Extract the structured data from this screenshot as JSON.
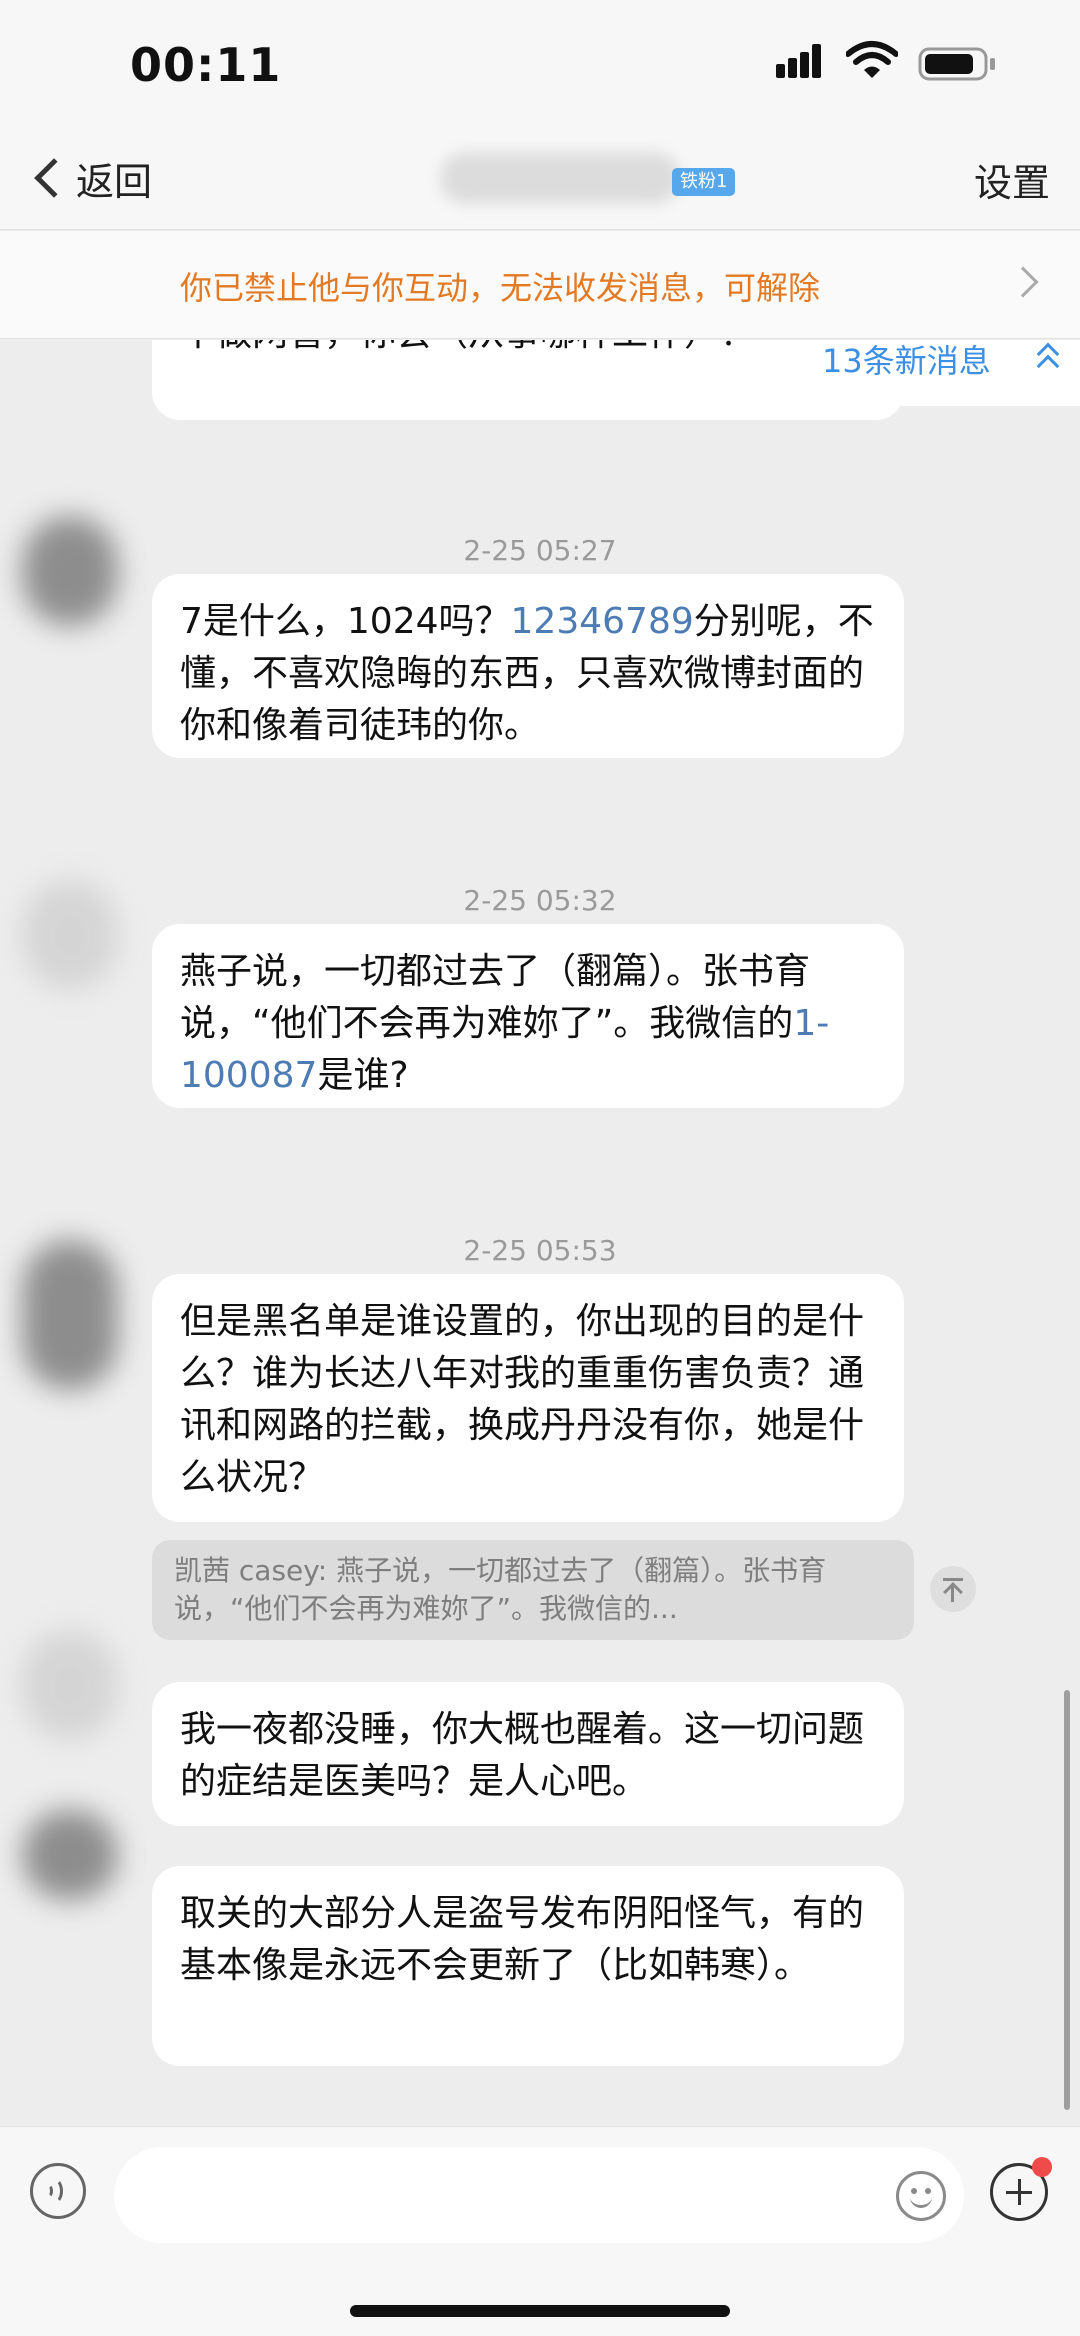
{
  "status_bar": {
    "time": "00:11"
  },
  "nav": {
    "back_label": "返回",
    "contact_badge": "铁粉1",
    "settings_label": "设置"
  },
  "banner": {
    "text": "你已禁止他与你互动，无法收发消息，可解除"
  },
  "new_messages": {
    "label": "13条新消息"
  },
  "messages": {
    "m0": "不做网管，你会（从事哪种工作）？",
    "t1": "2-25 05:27",
    "m1": {
      "a": "7是什么，1024吗？",
      "link": "12346789",
      "b": "分别呢，不懂，不喜欢隐晦的东西，只喜欢微博封面的你和像着司徒玮的你。"
    },
    "t2": "2-25 05:32",
    "m2": {
      "a": "燕子说，一切都过去了（翻篇）。张书育说，“他们不会再为难妳了”。我微信的",
      "link": "1-100087",
      "b": "是谁?"
    },
    "t3": "2-25 05:53",
    "m3": "但是黑名单是谁设置的，你出现的目的是什么？谁为长达八年对我的重重伤害负责？通讯和网路的拦截，换成丹丹没有你，她是什么状况？",
    "quote": "凯茜 casey: 燕子说，一切都过去了（翻篇）。张书育说，“他们不会再为难妳了”。我微信的...",
    "m4": "我一夜都没睡，你大概也醒着。这一切问题的症结是医美吗？是人心吧。",
    "m5": "取关的大部分人是盗号发布阴阳怪气，有的基本像是永远不会更新了（比如韩寒）。"
  },
  "colors": {
    "banner_text": "#e37a23",
    "link": "#4d7bb3",
    "new_message_accent": "#3b8fe4",
    "notification_dot": "#f04a4a"
  },
  "icons": {
    "back": "chevron-left-icon",
    "new_messages": "double-chevron-up-icon",
    "quote_jump": "jump-to-top-icon",
    "voice": "voice-icon",
    "emoji": "emoji-icon",
    "plus": "plus-icon"
  }
}
